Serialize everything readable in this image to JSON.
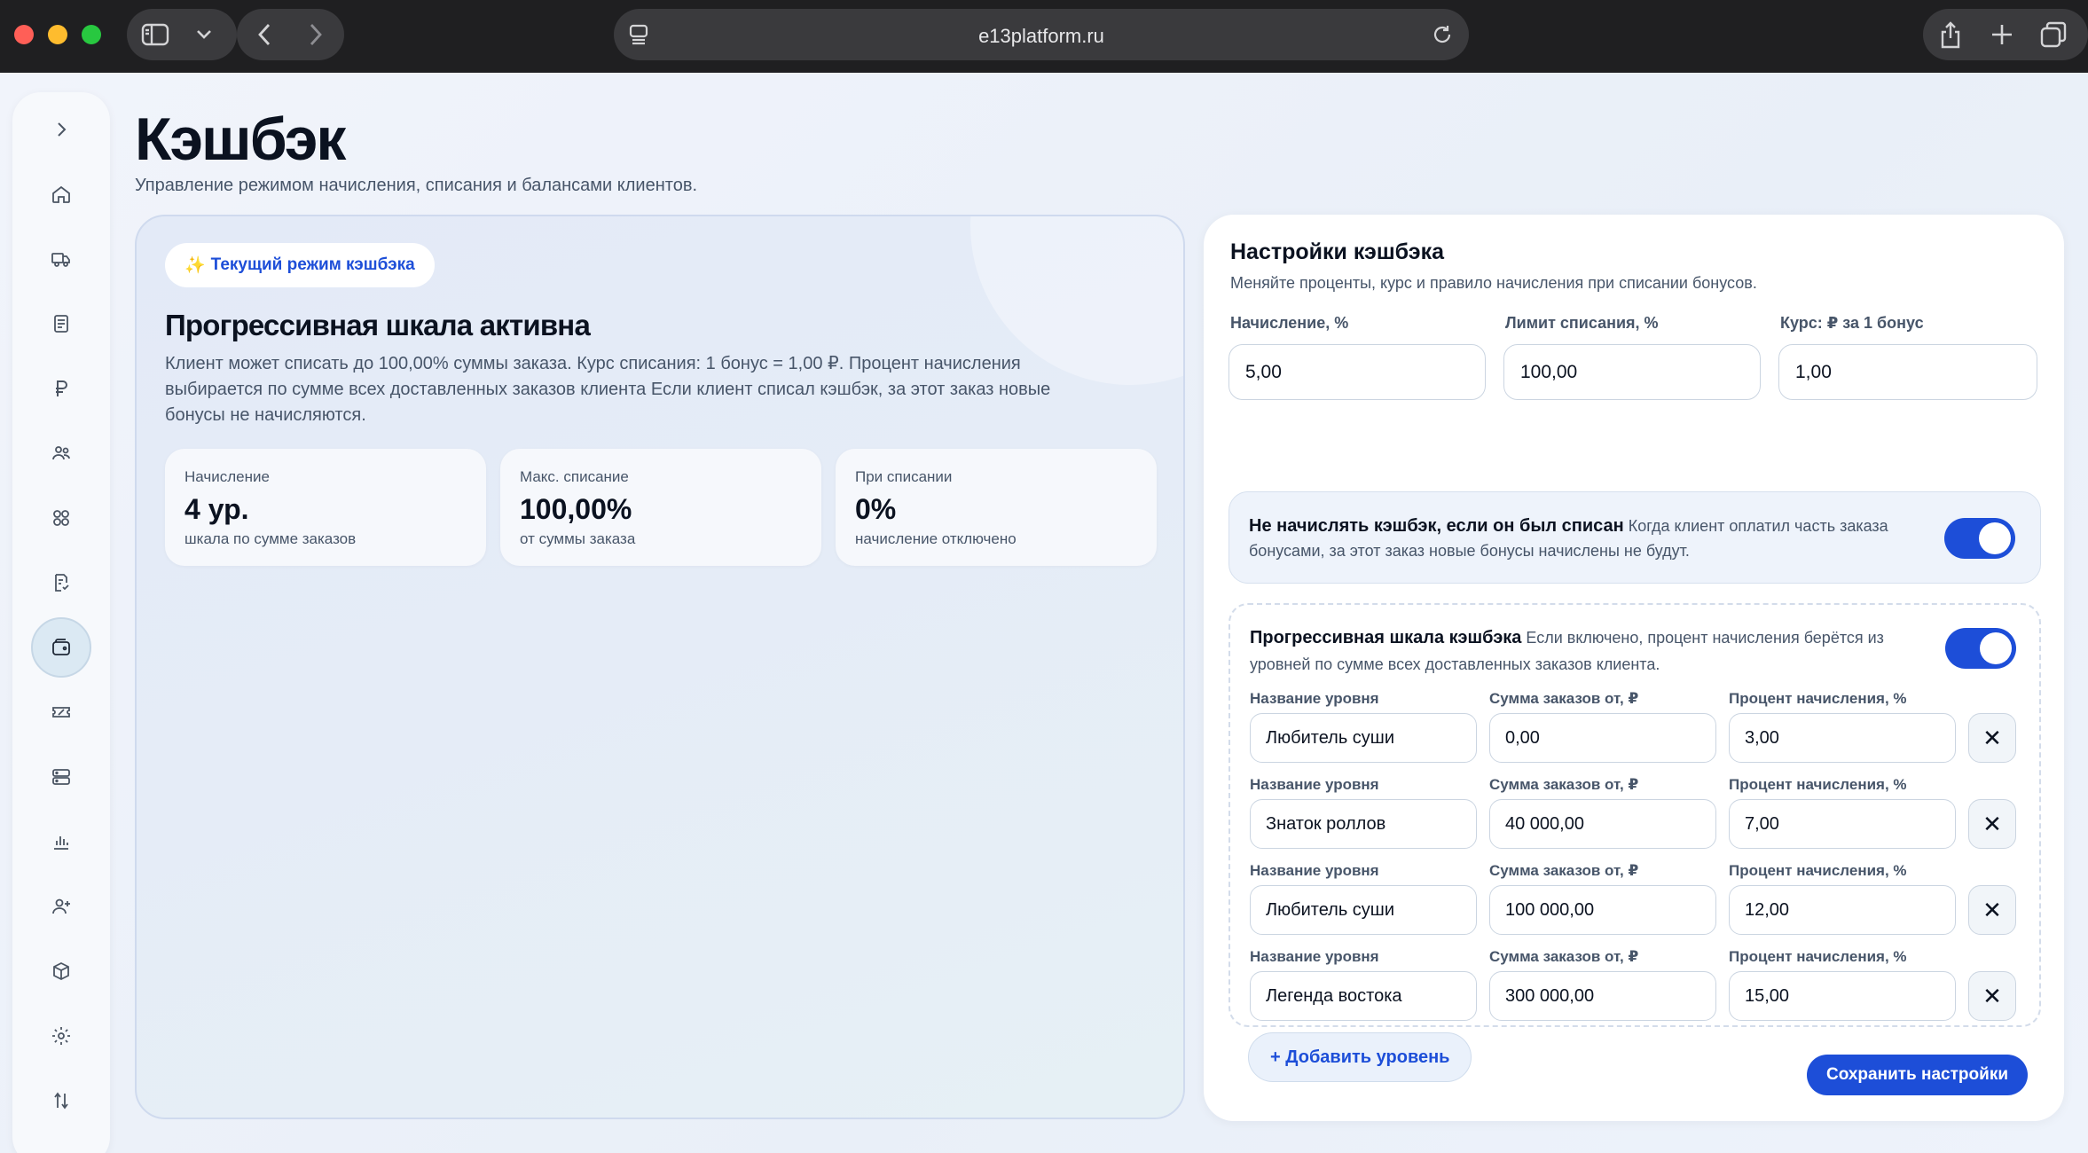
{
  "browser": {
    "url": "e13platform.ru"
  },
  "sidebar": {
    "items": [
      {
        "name": "expand-icon"
      },
      {
        "name": "home-icon"
      },
      {
        "name": "truck-icon"
      },
      {
        "name": "document-icon"
      },
      {
        "name": "ruble-icon"
      },
      {
        "name": "users-icon"
      },
      {
        "name": "grid-icon"
      },
      {
        "name": "orders-icon"
      },
      {
        "name": "wallet-icon",
        "active": true
      },
      {
        "name": "ticket-icon"
      },
      {
        "name": "storage-icon"
      },
      {
        "name": "chart-icon"
      },
      {
        "name": "add-user-icon"
      },
      {
        "name": "box-icon"
      },
      {
        "name": "gear-icon"
      },
      {
        "name": "transfer-icon"
      }
    ]
  },
  "page": {
    "title": "Кэшбэк",
    "subtitle": "Управление режимом начисления, списания и балансами клиентов."
  },
  "hero": {
    "badge": "Текущий режим кэшбэка",
    "title": "Прогрессивная шкала активна",
    "description": "Клиент может списать до 100,00% суммы заказа. Курс списания: 1 бонус = 1,00 ₽. Процент начисления выбирается по сумме всех доставленных заказов клиента Если клиент списал кэшбэк, за этот заказ новые бонусы не начисляются.",
    "stats": [
      {
        "label": "Начисление",
        "value": "4 ур.",
        "note": "шкала по сумме заказов"
      },
      {
        "label": "Макс. списание",
        "value": "100,00%",
        "note": "от суммы заказа"
      },
      {
        "label": "При списании",
        "value": "0%",
        "note": "начисление отключено"
      }
    ]
  },
  "settings": {
    "title": "Настройки кэшбэка",
    "subtitle": "Меняйте проценты, курс и правило начисления при списании бонусов.",
    "accrual_label": "Начисление, %",
    "accrual_value": "5,00",
    "limit_label": "Лимит списания, %",
    "limit_value": "100,00",
    "rate_label": "Курс: ₽ за 1 бонус",
    "rate_value": "1,00",
    "no_accrual_title": "Не начислять кэшбэк, если он был списан",
    "no_accrual_desc": "Когда клиент оплатил часть заказа бонусами, за этот заказ новые бонусы начислены не будут.",
    "no_accrual_enabled": true,
    "scale_title": "Прогрессивная шкала кэшбэка",
    "scale_desc": "Если включено, процент начисления берётся из уровней по сумме всех доставленных заказов клиента.",
    "scale_enabled": true,
    "tier_name_label": "Название уровня",
    "tier_sum_label": "Сумма заказов от, ₽",
    "tier_percent_label": "Процент начисления, %",
    "tiers": [
      {
        "name": "Любитель суши",
        "sum": "0,00",
        "percent": "3,00"
      },
      {
        "name": "Знаток роллов",
        "sum": "40 000,00",
        "percent": "7,00"
      },
      {
        "name": "Любитель суши",
        "sum": "100 000,00",
        "percent": "12,00"
      },
      {
        "name": "Легенда востока",
        "sum": "300 000,00",
        "percent": "15,00"
      }
    ],
    "remove_symbol": "✕",
    "add_tier_label": "+ Добавить уровень",
    "save_label": "Сохранить настройки"
  }
}
